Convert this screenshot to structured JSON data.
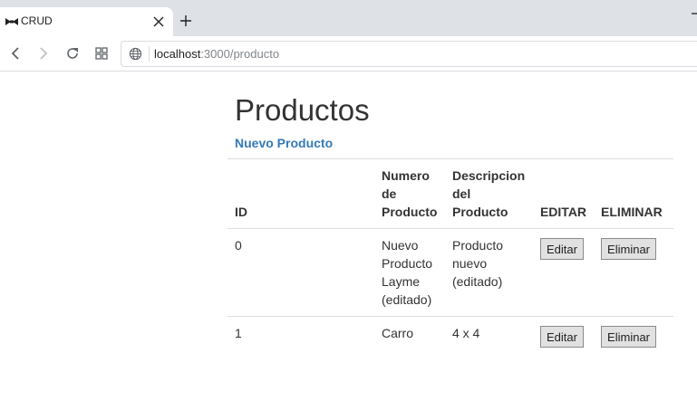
{
  "browser": {
    "tab_title": "CRUD",
    "url_host": "localhost",
    "url_rest": ":3000/producto"
  },
  "page": {
    "title": "Productos",
    "new_link": "Nuevo Producto"
  },
  "table": {
    "headers": {
      "id": "ID",
      "numero": "Numero de Producto",
      "descripcion": "Descripcion del Producto",
      "editar": "EDITAR",
      "eliminar": "ELIMINAR"
    },
    "rows": [
      {
        "id": "0",
        "numero": "Nuevo Producto Layme (editado)",
        "descripcion": "Producto nuevo (editado)",
        "edit_label": "Editar",
        "delete_label": "Eliminar"
      },
      {
        "id": "1",
        "numero": "Carro",
        "descripcion": "4 x 4",
        "edit_label": "Editar",
        "delete_label": "Eliminar"
      }
    ]
  }
}
